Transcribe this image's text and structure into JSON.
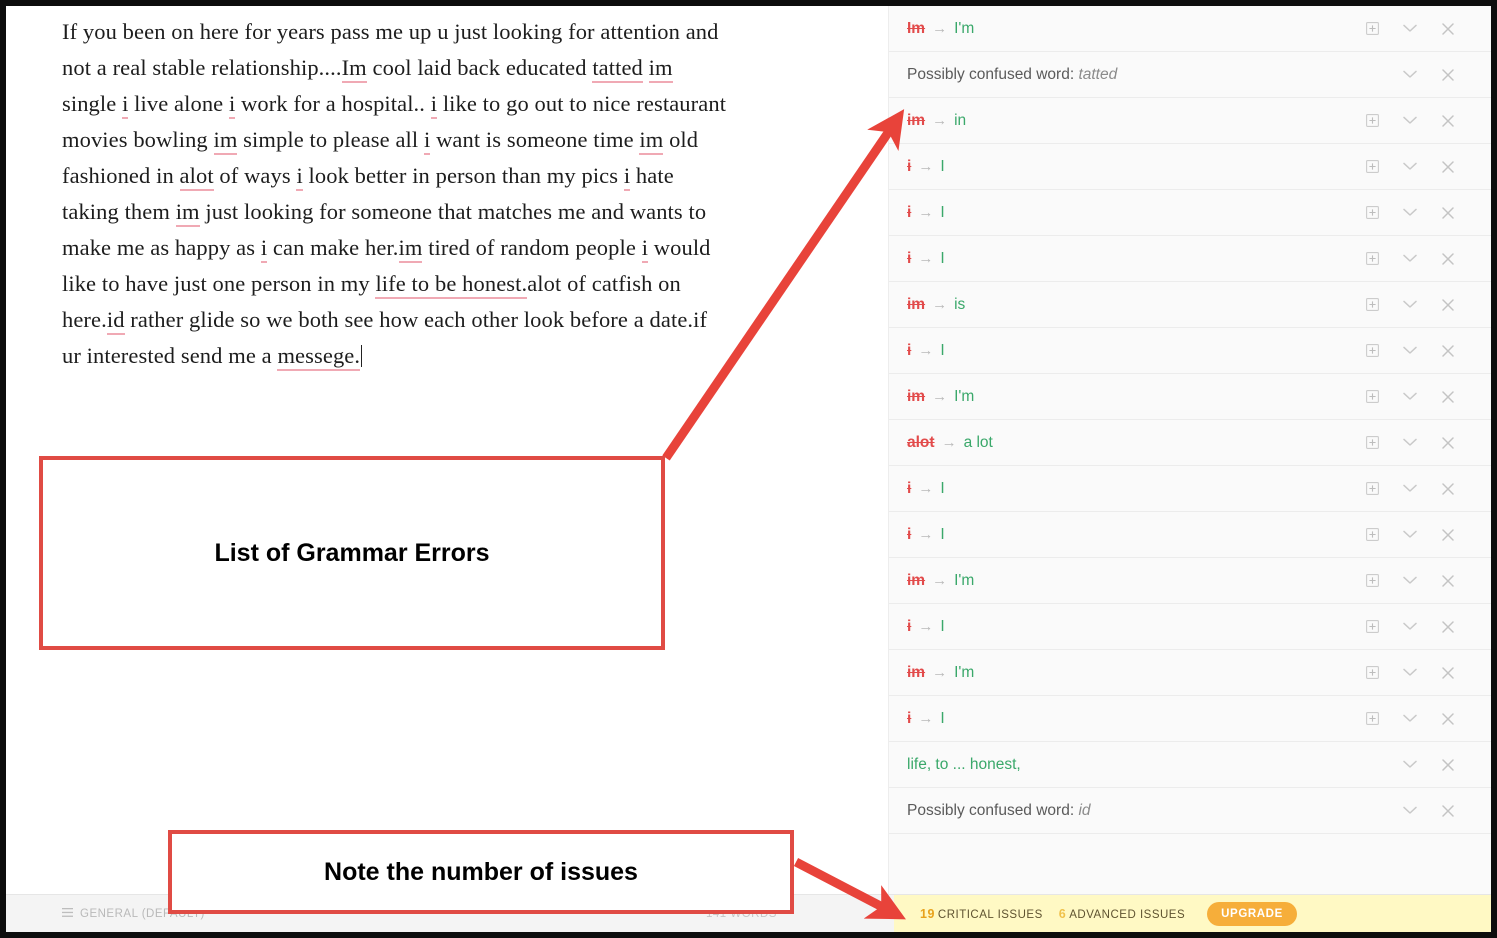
{
  "document": {
    "lines": [
      [
        {
          "t": "If you been on here for years pass me up u just looking for attention and",
          "e": false
        }
      ],
      [
        {
          "t": "not a real stable relationship....",
          "e": false
        },
        {
          "t": "Im",
          "e": true
        },
        {
          "t": " cool laid back educated ",
          "e": false
        },
        {
          "t": "tatted",
          "e": true
        },
        {
          "t": " ",
          "e": false
        },
        {
          "t": "im",
          "e": true
        }
      ],
      [
        {
          "t": "single ",
          "e": false
        },
        {
          "t": "i",
          "e": true
        },
        {
          "t": " live alone ",
          "e": false
        },
        {
          "t": "i",
          "e": true
        },
        {
          "t": " work for a hospital.. ",
          "e": false
        },
        {
          "t": "i",
          "e": true
        },
        {
          "t": " like to go out to nice restaurant",
          "e": false
        }
      ],
      [
        {
          "t": "movies bowling ",
          "e": false
        },
        {
          "t": "im",
          "e": true
        },
        {
          "t": " simple to please all ",
          "e": false
        },
        {
          "t": "i",
          "e": true
        },
        {
          "t": " want is someone time ",
          "e": false
        },
        {
          "t": "im",
          "e": true
        },
        {
          "t": " old",
          "e": false
        }
      ],
      [
        {
          "t": "fashioned in ",
          "e": false
        },
        {
          "t": "alot",
          "e": true
        },
        {
          "t": " of ways ",
          "e": false
        },
        {
          "t": "i",
          "e": true
        },
        {
          "t": " look better in person than my pics ",
          "e": false
        },
        {
          "t": "i",
          "e": true
        },
        {
          "t": " hate",
          "e": false
        }
      ],
      [
        {
          "t": "taking them ",
          "e": false
        },
        {
          "t": "im",
          "e": true
        },
        {
          "t": " just looking for someone that matches me and wants to",
          "e": false
        }
      ],
      [
        {
          "t": "make me as happy as ",
          "e": false
        },
        {
          "t": "i",
          "e": true
        },
        {
          "t": " can make her.",
          "e": false
        },
        {
          "t": "im",
          "e": true
        },
        {
          "t": " tired of random people ",
          "e": false
        },
        {
          "t": "i",
          "e": true
        },
        {
          "t": " would",
          "e": false
        }
      ],
      [
        {
          "t": "like to have just one person in my ",
          "e": false
        },
        {
          "t": "life to be honest.",
          "e": true
        },
        {
          "t": "alot of catfish on",
          "e": false
        }
      ],
      [
        {
          "t": "here.",
          "e": false
        },
        {
          "t": "id",
          "e": true
        },
        {
          "t": " rather glide so we both see how each other look before a date.if",
          "e": false
        }
      ],
      [
        {
          "t": "ur interested send me a ",
          "e": false
        },
        {
          "t": "messege.",
          "e": true
        }
      ]
    ]
  },
  "suggestions": {
    "items": [
      {
        "type": "replace",
        "old": "Im",
        "new": "I'm",
        "has_dict": true
      },
      {
        "type": "note",
        "label": "Possibly confused word:",
        "word": "tatted",
        "has_dict": false
      },
      {
        "type": "replace",
        "old": "im",
        "new": "in",
        "has_dict": true
      },
      {
        "type": "replace",
        "old": "i",
        "new": "I",
        "has_dict": true
      },
      {
        "type": "replace",
        "old": "i",
        "new": "I",
        "has_dict": true
      },
      {
        "type": "replace",
        "old": "i",
        "new": "I",
        "has_dict": true
      },
      {
        "type": "replace",
        "old": "im",
        "new": "is",
        "has_dict": true
      },
      {
        "type": "replace",
        "old": "i",
        "new": "I",
        "has_dict": true
      },
      {
        "type": "replace",
        "old": "im",
        "new": "I'm",
        "has_dict": true
      },
      {
        "type": "replace",
        "old": "alot",
        "new": "a lot",
        "has_dict": true
      },
      {
        "type": "replace",
        "old": "i",
        "new": "I",
        "has_dict": true
      },
      {
        "type": "replace",
        "old": "i",
        "new": "I",
        "has_dict": true
      },
      {
        "type": "replace",
        "old": "im",
        "new": "I'm",
        "has_dict": true
      },
      {
        "type": "replace",
        "old": "i",
        "new": "I",
        "has_dict": true
      },
      {
        "type": "replace",
        "old": "im",
        "new": "I'm",
        "has_dict": true
      },
      {
        "type": "replace",
        "old": "i",
        "new": "I",
        "has_dict": true
      },
      {
        "type": "green",
        "text": "life, to ... honest,",
        "has_dict": false
      },
      {
        "type": "note",
        "label": "Possibly confused word:",
        "word": "id",
        "has_dict": false
      }
    ],
    "arrow_symbol": "→",
    "icons": {
      "dictionary": "add-to-dictionary-icon",
      "expand": "chevron-down-icon",
      "dismiss": "close-icon"
    }
  },
  "statusbar": {
    "style_icon": "list-icon",
    "style_label": "GENERAL (DEFAULT)",
    "word_count": "141 WORDS",
    "critical_count": "19",
    "critical_label": "CRITICAL ISSUES",
    "advanced_count": "6",
    "advanced_label": "ADVANCED ISSUES",
    "upgrade_label": "UPGRADE"
  },
  "annotations": {
    "callout_1": "List of Grammar Errors",
    "callout_2": "Note the number of issues",
    "accent_color": "#e04b44",
    "highlight_color": "#fff9c4"
  }
}
